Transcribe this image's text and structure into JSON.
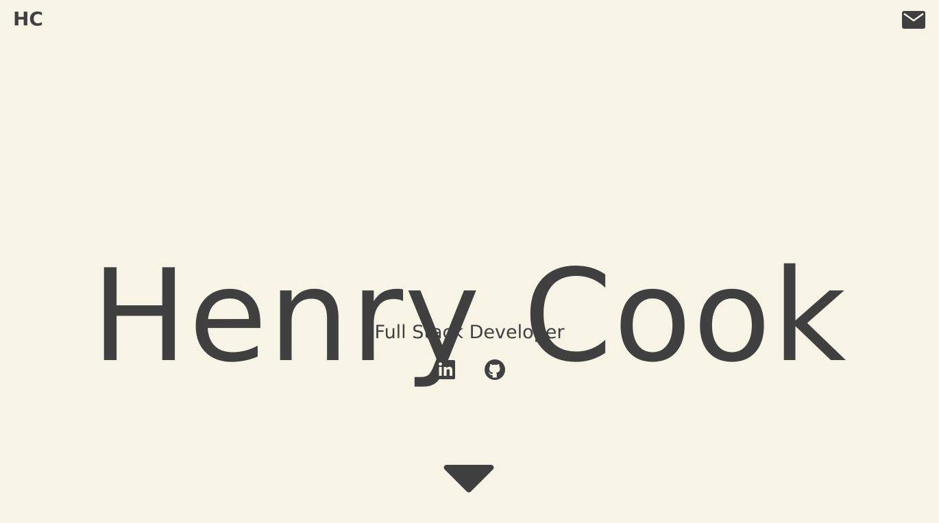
{
  "header": {
    "logo_text": "HC",
    "mail_icon": "envelope-icon"
  },
  "hero": {
    "name": "Henry Cook",
    "subtitle": "Full Stack Developer"
  },
  "social": {
    "items": [
      {
        "icon": "linkedin-icon"
      },
      {
        "icon": "github-icon"
      }
    ]
  },
  "scroll": {
    "icon": "caret-down-icon"
  },
  "colors": {
    "background": "#f7f4e6",
    "text": "#404040"
  }
}
